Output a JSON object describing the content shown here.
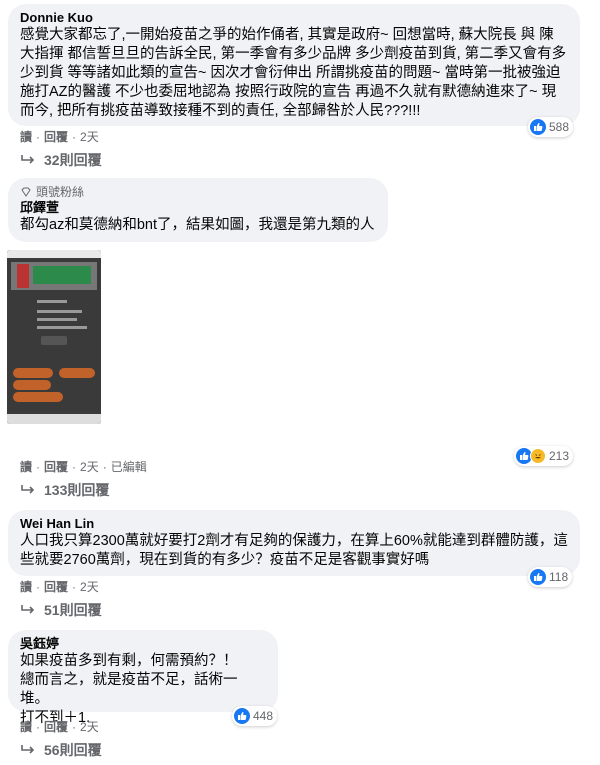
{
  "comments": [
    {
      "author": "Donnie Kuo",
      "text": "感覺大家都忘了,一開始疫苗之爭的始作俑者, 其實是政府~ 回想當時, 蘇大院長 與 陳大指揮 都信誓旦旦的告訴全民, 第一季會有多少品牌 多少劑疫苗到貨, 第二季又會有多少到貨 等等諸如此類的宣告~ 因次才會衍伸出 所謂挑疫苗的問題~ 當時第一批被強迫施打AZ的醫護 不少也委屈地認為 按照行政院的宣告 再過不久就有默德納進來了~ 現而今, 把所有挑疫苗導致接種不到的責任, 全部歸咎於人民???!!!",
      "reaction_count": "588",
      "actions": {
        "read": "讀",
        "reply": "回覆",
        "time": "2天"
      },
      "replies": "32則回覆"
    },
    {
      "badge": "頭號粉絲",
      "author": "邱鐸萱",
      "text": "都勾az和莫德納和bnt了，結果如圖，我還是第九類的人",
      "reaction_count": "213",
      "actions": {
        "read": "讀",
        "reply": "回覆",
        "time": "2天",
        "edited": "已編輯"
      },
      "replies": "133則回覆",
      "image": {
        "banner": "第2.5 COVID-19 公費疫苗接種意願登記",
        "result": "結果",
        "bubbles": [
          "",
          "",
          "",
          ""
        ]
      }
    },
    {
      "author": "Wei Han Lin",
      "text": "人口我只算2300萬就好要打2劑才有足夠的保護力，在算上60%就能達到群體防護，這些就要2760萬劑，現在到貨的有多少？疫苗不足是客觀事實好嗎",
      "reaction_count": "118",
      "actions": {
        "read": "讀",
        "reply": "回覆",
        "time": "2天"
      },
      "replies": "51則回覆"
    },
    {
      "author": "吳鈺婷",
      "text": "如果疫苗多到有剩，何需預約？！\n總而言之，就是疫苗不足，話術一堆。\n打不到＋1.",
      "reaction_count": "448",
      "actions": {
        "read": "讀",
        "reply": "回覆",
        "time": "2天"
      },
      "replies": "56則回覆"
    }
  ],
  "colors": {
    "like": "#1877f2",
    "bubble": "#f0f2f5",
    "muted": "#65676b"
  }
}
